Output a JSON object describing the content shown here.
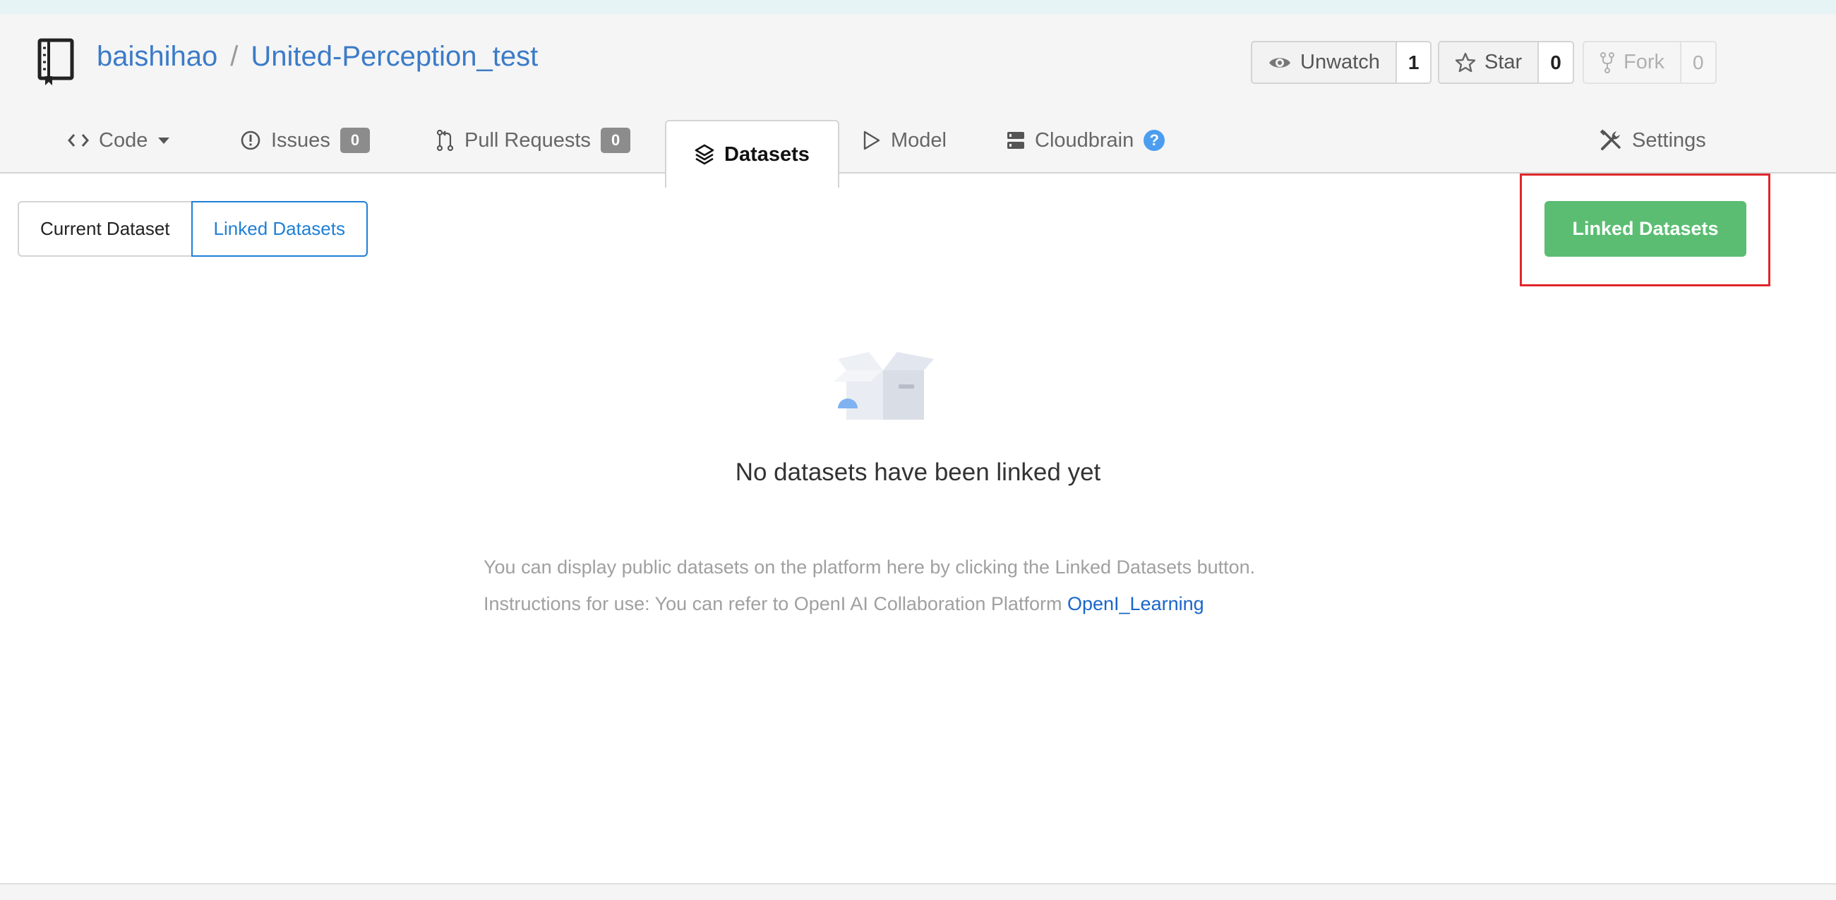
{
  "repo": {
    "owner": "baishihao",
    "separator": "/",
    "name": "United-Perception_test",
    "icon": "repo-book-icon"
  },
  "actions": {
    "watch": {
      "label": "Unwatch",
      "count": "1",
      "icon": "eye-icon"
    },
    "star": {
      "label": "Star",
      "count": "0",
      "icon": "star-icon"
    },
    "fork": {
      "label": "Fork",
      "count": "0",
      "icon": "fork-icon"
    }
  },
  "tabs": [
    {
      "label": "Code",
      "icon": "code-icon"
    },
    {
      "label": "Issues",
      "badge": "0",
      "icon": "issue-icon"
    },
    {
      "label": "Pull Requests",
      "badge": "0",
      "icon": "pull-request-icon"
    },
    {
      "label": "Datasets",
      "icon": "layers-icon",
      "active": true
    },
    {
      "label": "Model",
      "icon": "play-outline-icon"
    },
    {
      "label": "Cloudbrain",
      "icon": "server-icon",
      "help": "?"
    },
    {
      "label": "Settings",
      "icon": "tools-icon"
    }
  ],
  "dataset_toggle": {
    "current_label": "Current Dataset",
    "linked_label": "Linked Datasets",
    "selected": "Linked Datasets"
  },
  "primary_button": {
    "label": "Linked Datasets",
    "color": "#5bbd72"
  },
  "empty_state": {
    "icon": "empty-box-icon",
    "title": "No datasets have been linked yet",
    "line1": "You can display public datasets on the platform here by clicking the Linked Datasets button.",
    "line2_prefix": "Instructions for use: You can refer to OpenI AI Collaboration Platform ",
    "line2_link": "OpenI_Learning"
  },
  "colors": {
    "link": "#3b7bc7",
    "accent_blue": "#1f7fd6",
    "highlight_red": "#e0272b"
  }
}
